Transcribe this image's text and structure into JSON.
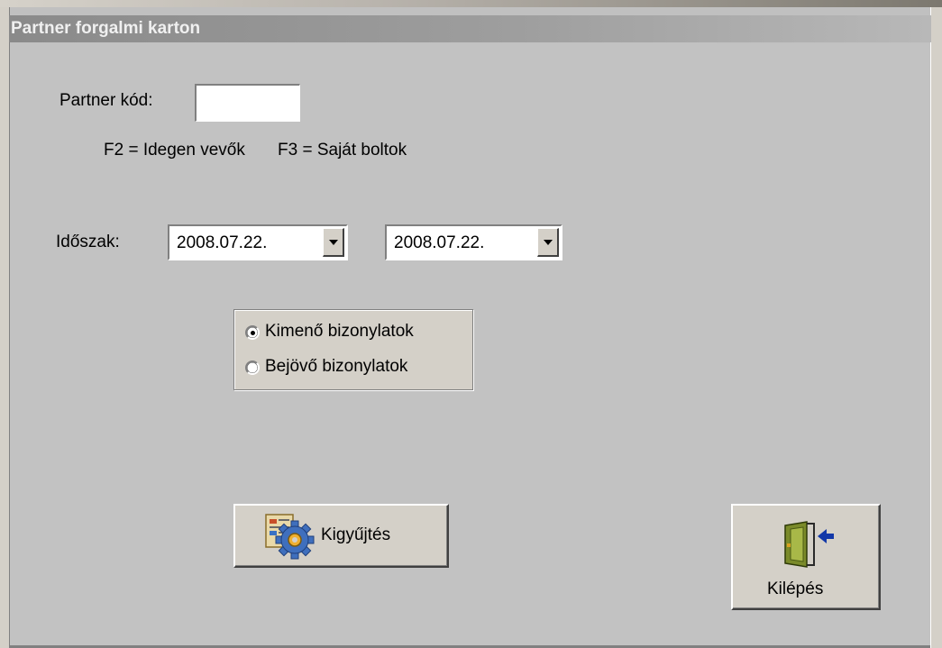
{
  "window": {
    "title": "Partner forgalmi karton"
  },
  "partner": {
    "label": "Partner kód:",
    "value": "",
    "hint_f2": "F2 = Idegen vevők",
    "hint_f3": "F3 = Saját boltok"
  },
  "period": {
    "label": "Időszak:",
    "from": "2008.07.22.",
    "to": "2008.07.22."
  },
  "direction": {
    "options": [
      {
        "label": "Kimenő bizonylatok",
        "selected": true
      },
      {
        "label": "Bejövő bizonylatok",
        "selected": false
      }
    ]
  },
  "buttons": {
    "collect_label": "Kigyűjtés",
    "collect_icon": "gear-document-icon",
    "exit_label": "Kilépés",
    "exit_icon": "door-exit-icon"
  }
}
